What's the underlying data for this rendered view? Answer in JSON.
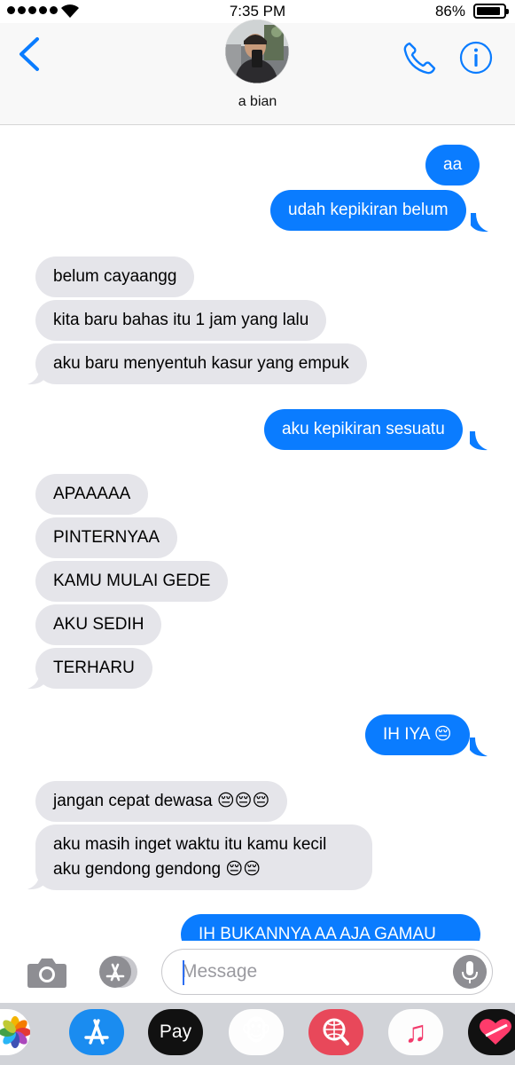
{
  "status_bar": {
    "time": "7:35 PM",
    "battery": "86%",
    "battery_level": 0.86,
    "icons": [
      "signal-icon",
      "wifi-icon",
      "battery-icon"
    ]
  },
  "header": {
    "contact_name": "a bian",
    "icons": [
      "back-icon",
      "avatar",
      "phone-icon",
      "info-icon"
    ],
    "accent": "#0a7cff"
  },
  "messages": [
    {
      "from": "me",
      "text": "aa"
    },
    {
      "from": "me",
      "text": "udah kepikiran belum"
    },
    {
      "from": "them",
      "text": "belum cayaangg"
    },
    {
      "from": "them",
      "text": "kita baru bahas itu 1 jam yang lalu"
    },
    {
      "from": "them",
      "text": "aku baru menyentuh kasur yang empuk"
    },
    {
      "from": "me",
      "text": "aku kepikiran sesuatu"
    },
    {
      "from": "them",
      "text": "APAAAAA"
    },
    {
      "from": "them",
      "text": "PINTERNYAA"
    },
    {
      "from": "them",
      "text": "KAMU MULAI GEDE"
    },
    {
      "from": "them",
      "text": "AKU SEDIH"
    },
    {
      "from": "them",
      "text": "TERHARU"
    },
    {
      "from": "me",
      "text": "IH IYA 😔"
    },
    {
      "from": "them",
      "text": "jangan cepat dewasa 😔😔😔"
    },
    {
      "from": "them",
      "text": "aku masih inget waktu itu kamu kecil aku gendong gendong 😔😔"
    },
    {
      "from": "me",
      "text": "IH BUKANNYA AA AJA GAMAU"
    }
  ],
  "input_bar": {
    "placeholder": "Message",
    "value": "",
    "icons": [
      "camera-icon",
      "app-store-icon",
      "microphone-icon"
    ]
  },
  "app_drawer": {
    "apps": [
      {
        "name": "photos-app-icon",
        "label": ""
      },
      {
        "name": "app-store-app-icon",
        "label": ""
      },
      {
        "name": "apple-pay-app-icon",
        "label": "Pay"
      },
      {
        "name": "animoji-app-icon",
        "label": "🐵"
      },
      {
        "name": "web-images-app-icon",
        "label": ""
      },
      {
        "name": "music-app-icon",
        "label": "♫"
      },
      {
        "name": "digital-touch-app-icon",
        "label": ""
      }
    ]
  },
  "colors": {
    "outgoing_bubble": "#0a7cff",
    "incoming_bubble": "#e5e5ea",
    "drawer_background": "#d1d3d8"
  }
}
